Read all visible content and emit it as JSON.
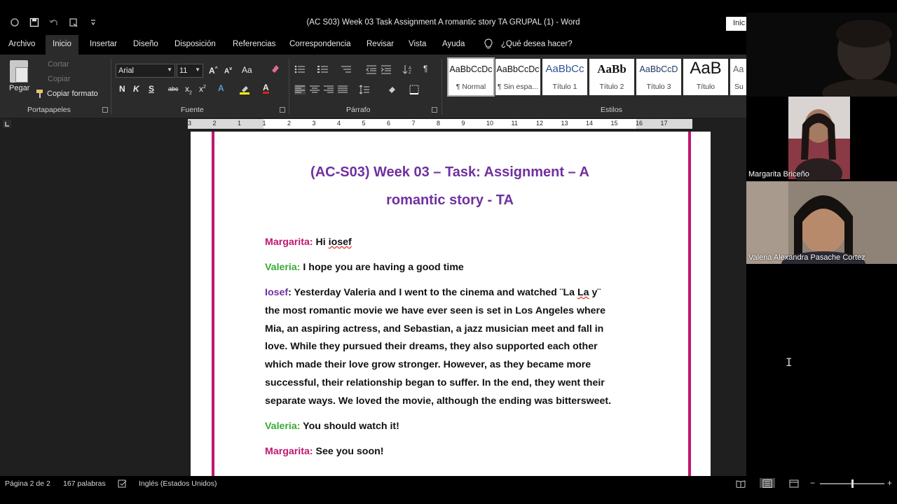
{
  "window": {
    "title": "(AC S03) Week 03 Task Assignment A romantic story  TA GRUPAL (1)  -  Word",
    "signin_label": "Inic"
  },
  "qat": {
    "autosave_icon": "autosave-icon",
    "save_icon": "save-icon",
    "undo_icon": "undo-icon",
    "redo_icon": "repeat-icon",
    "customize_icon": "customize-qat-icon"
  },
  "ribbon_tabs": [
    "Archivo",
    "Inicio",
    "Insertar",
    "Diseño",
    "Disposición",
    "Referencias",
    "Correspondencia",
    "Revisar",
    "Vista",
    "Ayuda"
  ],
  "tellme": "¿Qué desea hacer?",
  "clipboard": {
    "paste": "Pegar",
    "cut": "Cortar",
    "copy": "Copiar",
    "format_painter": "Copiar formato",
    "group": "Portapapeles"
  },
  "font": {
    "name": "Arial",
    "size": "11",
    "group": "Fuente",
    "bold": "N",
    "italic": "K",
    "underline": "S",
    "strike": "abc",
    "subscript": "x",
    "change_case": "Aa"
  },
  "paragraph": {
    "group": "Párrafo"
  },
  "styles": {
    "group": "Estilos",
    "items": [
      {
        "preview": "AaBbCcDc",
        "name": "¶ Normal"
      },
      {
        "preview": "AaBbCcDc",
        "name": "¶ Sin espa..."
      },
      {
        "preview": "AaBbCc",
        "name": "Título 1"
      },
      {
        "preview": "AaBb",
        "name": "Título 2"
      },
      {
        "preview": "AaBbCcD",
        "name": "Título 3"
      },
      {
        "preview": "AaB",
        "name": "Título"
      },
      {
        "preview": "Aa",
        "name": "Su"
      }
    ]
  },
  "ruler": {
    "numbers": [
      "3",
      "2",
      "1",
      "1",
      "2",
      "3",
      "4",
      "5",
      "6",
      "7",
      "8",
      "9",
      "10",
      "11",
      "12",
      "13",
      "14",
      "15",
      "16",
      "17"
    ]
  },
  "document": {
    "title_line1": "(AC-S03) Week 03 – Task: Assignment – A",
    "title_line2": "romantic story - TA",
    "lines": [
      {
        "speaker": "Margarita:",
        "text": " Hi ",
        "underlined": "iosef"
      },
      {
        "speaker": "Valeria:",
        "text": " I hope you are having a good time"
      },
      {
        "speaker": "Iosef",
        "first": ": Yesterday Valeria and I went to the cinema and watched ¨La ",
        "squig": "La",
        "first_end": " y¨",
        "rest": [
          "the most romantic movie we have ever seen is set in Los Angeles where",
          "Mia, an aspiring actress, and Sebastian, a jazz musician meet and fall in",
          "love. While they pursued their dreams, they also supported each other",
          "which made their love grow stronger. However, as they became more",
          "successful, their relationship began to suffer. In the end, they went their",
          "separate ways. We loved the movie, although the ending was bittersweet."
        ]
      },
      {
        "speaker": "Valeria:",
        "text": " You should watch it!"
      },
      {
        "speaker": "Margarita:",
        "text": " See you soon!"
      }
    ]
  },
  "status": {
    "page": "Página 2 de 2",
    "words": "167 palabras",
    "language": "Inglés (Estados Unidos)",
    "zoom_minus": "−",
    "zoom_plus": "+"
  },
  "participants": [
    {
      "name": ""
    },
    {
      "name": "Margarita Briceño"
    },
    {
      "name": "Valeria Alexandra Pasache Cortez"
    }
  ],
  "colors": {
    "accent_pink": "#c0166f",
    "green": "#3aaa35",
    "purple": "#7030a0"
  }
}
